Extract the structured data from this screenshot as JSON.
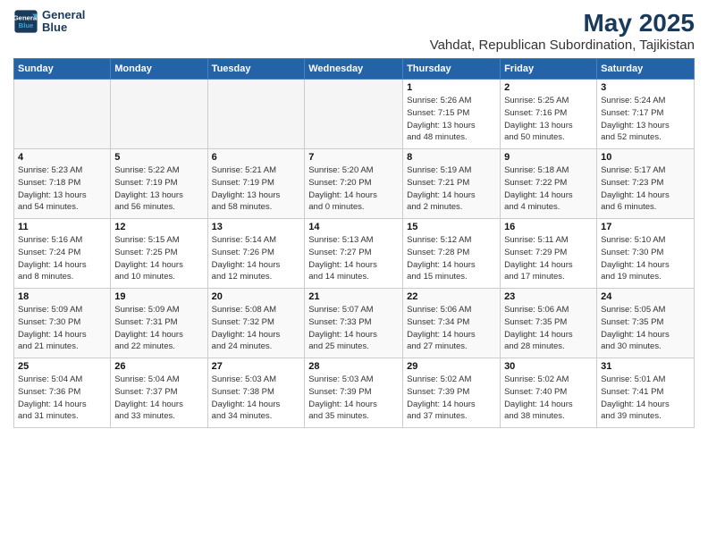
{
  "header": {
    "logo_line1": "General",
    "logo_line2": "Blue",
    "title": "May 2025",
    "subtitle": "Vahdat, Republican Subordination, Tajikistan"
  },
  "columns": [
    "Sunday",
    "Monday",
    "Tuesday",
    "Wednesday",
    "Thursday",
    "Friday",
    "Saturday"
  ],
  "weeks": [
    [
      {
        "day": "",
        "info": ""
      },
      {
        "day": "",
        "info": ""
      },
      {
        "day": "",
        "info": ""
      },
      {
        "day": "",
        "info": ""
      },
      {
        "day": "1",
        "info": "Sunrise: 5:26 AM\nSunset: 7:15 PM\nDaylight: 13 hours\nand 48 minutes."
      },
      {
        "day": "2",
        "info": "Sunrise: 5:25 AM\nSunset: 7:16 PM\nDaylight: 13 hours\nand 50 minutes."
      },
      {
        "day": "3",
        "info": "Sunrise: 5:24 AM\nSunset: 7:17 PM\nDaylight: 13 hours\nand 52 minutes."
      }
    ],
    [
      {
        "day": "4",
        "info": "Sunrise: 5:23 AM\nSunset: 7:18 PM\nDaylight: 13 hours\nand 54 minutes."
      },
      {
        "day": "5",
        "info": "Sunrise: 5:22 AM\nSunset: 7:19 PM\nDaylight: 13 hours\nand 56 minutes."
      },
      {
        "day": "6",
        "info": "Sunrise: 5:21 AM\nSunset: 7:19 PM\nDaylight: 13 hours\nand 58 minutes."
      },
      {
        "day": "7",
        "info": "Sunrise: 5:20 AM\nSunset: 7:20 PM\nDaylight: 14 hours\nand 0 minutes."
      },
      {
        "day": "8",
        "info": "Sunrise: 5:19 AM\nSunset: 7:21 PM\nDaylight: 14 hours\nand 2 minutes."
      },
      {
        "day": "9",
        "info": "Sunrise: 5:18 AM\nSunset: 7:22 PM\nDaylight: 14 hours\nand 4 minutes."
      },
      {
        "day": "10",
        "info": "Sunrise: 5:17 AM\nSunset: 7:23 PM\nDaylight: 14 hours\nand 6 minutes."
      }
    ],
    [
      {
        "day": "11",
        "info": "Sunrise: 5:16 AM\nSunset: 7:24 PM\nDaylight: 14 hours\nand 8 minutes."
      },
      {
        "day": "12",
        "info": "Sunrise: 5:15 AM\nSunset: 7:25 PM\nDaylight: 14 hours\nand 10 minutes."
      },
      {
        "day": "13",
        "info": "Sunrise: 5:14 AM\nSunset: 7:26 PM\nDaylight: 14 hours\nand 12 minutes."
      },
      {
        "day": "14",
        "info": "Sunrise: 5:13 AM\nSunset: 7:27 PM\nDaylight: 14 hours\nand 14 minutes."
      },
      {
        "day": "15",
        "info": "Sunrise: 5:12 AM\nSunset: 7:28 PM\nDaylight: 14 hours\nand 15 minutes."
      },
      {
        "day": "16",
        "info": "Sunrise: 5:11 AM\nSunset: 7:29 PM\nDaylight: 14 hours\nand 17 minutes."
      },
      {
        "day": "17",
        "info": "Sunrise: 5:10 AM\nSunset: 7:30 PM\nDaylight: 14 hours\nand 19 minutes."
      }
    ],
    [
      {
        "day": "18",
        "info": "Sunrise: 5:09 AM\nSunset: 7:30 PM\nDaylight: 14 hours\nand 21 minutes."
      },
      {
        "day": "19",
        "info": "Sunrise: 5:09 AM\nSunset: 7:31 PM\nDaylight: 14 hours\nand 22 minutes."
      },
      {
        "day": "20",
        "info": "Sunrise: 5:08 AM\nSunset: 7:32 PM\nDaylight: 14 hours\nand 24 minutes."
      },
      {
        "day": "21",
        "info": "Sunrise: 5:07 AM\nSunset: 7:33 PM\nDaylight: 14 hours\nand 25 minutes."
      },
      {
        "day": "22",
        "info": "Sunrise: 5:06 AM\nSunset: 7:34 PM\nDaylight: 14 hours\nand 27 minutes."
      },
      {
        "day": "23",
        "info": "Sunrise: 5:06 AM\nSunset: 7:35 PM\nDaylight: 14 hours\nand 28 minutes."
      },
      {
        "day": "24",
        "info": "Sunrise: 5:05 AM\nSunset: 7:35 PM\nDaylight: 14 hours\nand 30 minutes."
      }
    ],
    [
      {
        "day": "25",
        "info": "Sunrise: 5:04 AM\nSunset: 7:36 PM\nDaylight: 14 hours\nand 31 minutes."
      },
      {
        "day": "26",
        "info": "Sunrise: 5:04 AM\nSunset: 7:37 PM\nDaylight: 14 hours\nand 33 minutes."
      },
      {
        "day": "27",
        "info": "Sunrise: 5:03 AM\nSunset: 7:38 PM\nDaylight: 14 hours\nand 34 minutes."
      },
      {
        "day": "28",
        "info": "Sunrise: 5:03 AM\nSunset: 7:39 PM\nDaylight: 14 hours\nand 35 minutes."
      },
      {
        "day": "29",
        "info": "Sunrise: 5:02 AM\nSunset: 7:39 PM\nDaylight: 14 hours\nand 37 minutes."
      },
      {
        "day": "30",
        "info": "Sunrise: 5:02 AM\nSunset: 7:40 PM\nDaylight: 14 hours\nand 38 minutes."
      },
      {
        "day": "31",
        "info": "Sunrise: 5:01 AM\nSunset: 7:41 PM\nDaylight: 14 hours\nand 39 minutes."
      }
    ]
  ]
}
